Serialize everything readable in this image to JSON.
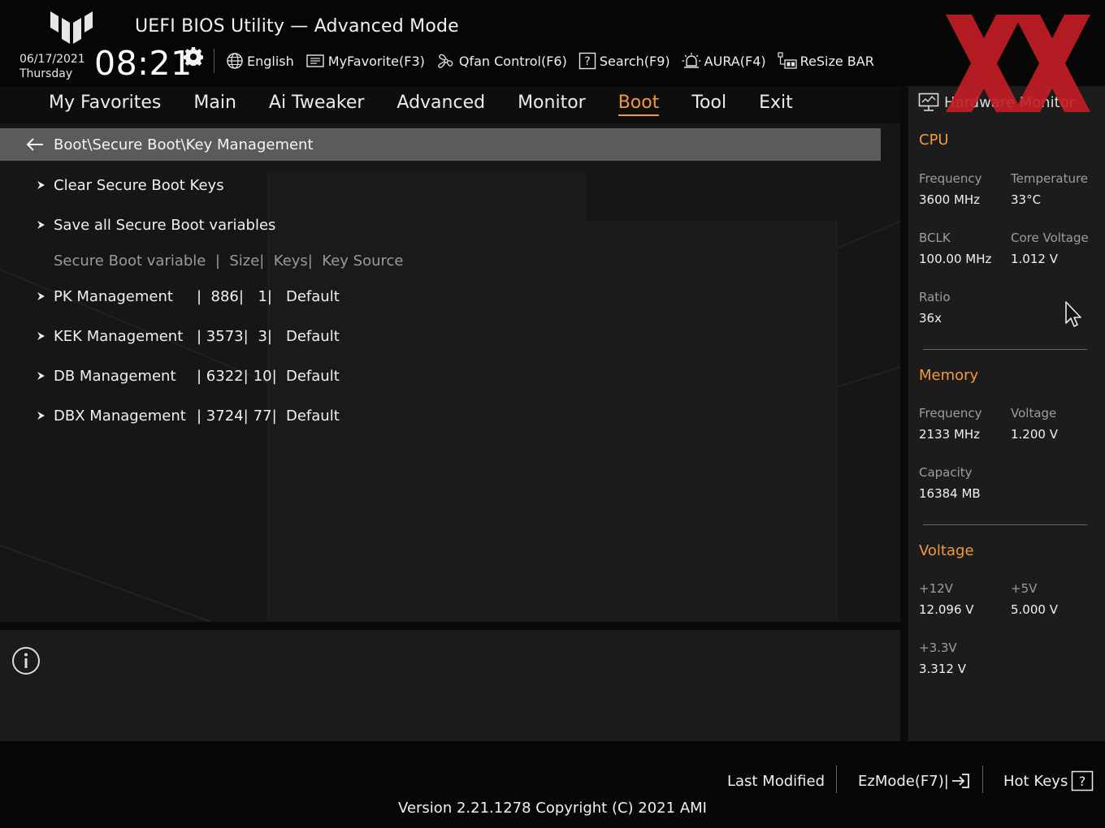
{
  "header": {
    "title": "UEFI BIOS Utility — Advanced Mode",
    "date": "06/17/2021",
    "weekday": "Thursday",
    "time": "08:21",
    "toolbar": [
      {
        "label": "English",
        "icon": "globe-icon"
      },
      {
        "label": "MyFavorite(F3)",
        "icon": "favorite-list-icon"
      },
      {
        "label": "Qfan Control(F6)",
        "icon": "fan-icon"
      },
      {
        "label": "Search(F9)",
        "icon": "search-help-icon"
      },
      {
        "label": "AURA(F4)",
        "icon": "aura-light-icon"
      },
      {
        "label": "ReSize BAR",
        "icon": "resize-bar-icon"
      }
    ]
  },
  "menu": {
    "tabs": [
      "My Favorites",
      "Main",
      "Ai Tweaker",
      "Advanced",
      "Monitor",
      "Boot",
      "Tool",
      "Exit"
    ],
    "active": "Boot"
  },
  "main": {
    "breadcrumb": "Boot\\Secure Boot\\Key Management",
    "actions": [
      "Clear Secure Boot Keys",
      "Save all Secure Boot variables"
    ],
    "table_header": "Secure Boot variable  |  Size|  Keys|  Key Source",
    "rows": [
      {
        "name": "PK Management",
        "size": "|  886|",
        "keys": "  1|",
        "source": "Default"
      },
      {
        "name": "KEK Management",
        "size": "| 3573|",
        "keys": "  3|",
        "source": "Default"
      },
      {
        "name": "DB Management",
        "size": "| 6322|",
        "keys": " 10|",
        "source": "Default"
      },
      {
        "name": "DBX Management",
        "size": "| 3724|",
        "keys": " 77|",
        "source": "Default"
      }
    ]
  },
  "hardware_monitor": {
    "title": "Hardware Monitor",
    "cpu": {
      "section": "CPU",
      "frequency_label": "Frequency",
      "frequency": "3600 MHz",
      "temperature_label": "Temperature",
      "temperature": "33°C",
      "bclk_label": "BCLK",
      "bclk": "100.00 MHz",
      "core_voltage_label": "Core Voltage",
      "core_voltage": "1.012 V",
      "ratio_label": "Ratio",
      "ratio": "36x"
    },
    "memory": {
      "section": "Memory",
      "frequency_label": "Frequency",
      "frequency": "2133 MHz",
      "voltage_label": "Voltage",
      "voltage": "1.200 V",
      "capacity_label": "Capacity",
      "capacity": "16384 MB"
    },
    "voltage": {
      "section": "Voltage",
      "v12_label": "+12V",
      "v12": "12.096 V",
      "v5_label": "+5V",
      "v5": "5.000 V",
      "v33_label": "+3.3V",
      "v33": "3.312 V"
    }
  },
  "footer": {
    "last_modified": "Last Modified",
    "ezmode": "EzMode(F7)|",
    "hotkeys": "Hot Keys",
    "version": "Version 2.21.1278 Copyright (C) 2021 AMI"
  },
  "colors": {
    "accent": "#f29a3b",
    "watermark": "#c41e24",
    "breadcrumb_bg": "#5b5b5b"
  }
}
